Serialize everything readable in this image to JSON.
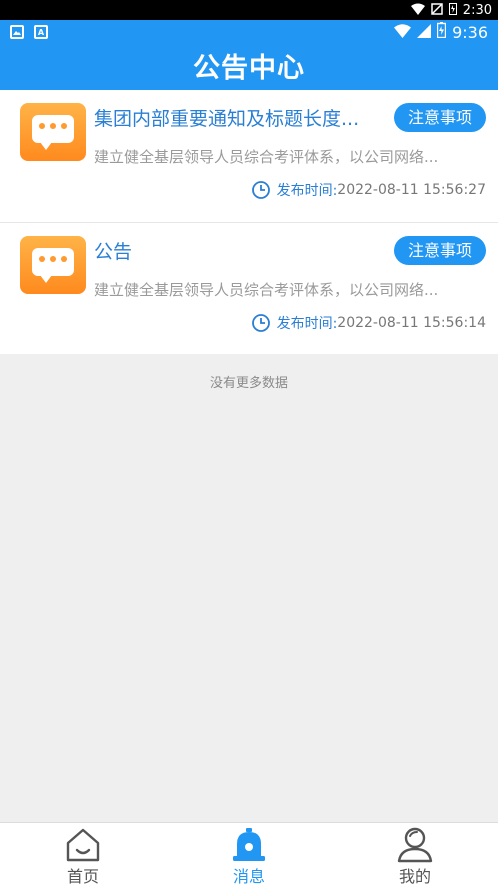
{
  "system_status": {
    "time": "2:30"
  },
  "app_status": {
    "time": "9:36"
  },
  "header": {
    "title": "公告中心"
  },
  "notices": [
    {
      "title": "集团内部重要通知及标题长度...",
      "tag": "注意事项",
      "summary": "建立健全基层领导人员综合考评体系，以公司网络...",
      "time_label": "发布时间:",
      "time_value": "2022-08-11 15:56:27"
    },
    {
      "title": "公告",
      "tag": "注意事项",
      "summary": "建立健全基层领导人员综合考评体系，以公司网络...",
      "time_label": "发布时间:",
      "time_value": "2022-08-11 15:56:14"
    }
  ],
  "list_end_text": "没有更多数据",
  "tabs": [
    {
      "label": "首页",
      "icon": "home-icon",
      "active": false
    },
    {
      "label": "消息",
      "icon": "bell-icon",
      "active": true
    },
    {
      "label": "我的",
      "icon": "user-icon",
      "active": false
    }
  ],
  "colors": {
    "primary": "#2196f3",
    "accent_orange": "#ff8a1e",
    "title_blue": "#2a7fd4"
  }
}
